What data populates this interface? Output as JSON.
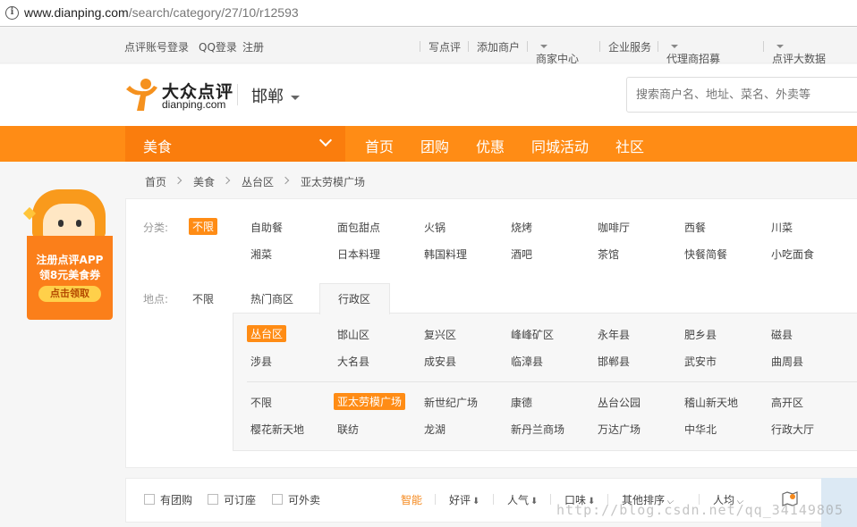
{
  "browser": {
    "url_host": "www.dianping.com",
    "url_path": "/search/category/27/10/r12593"
  },
  "topbar": {
    "login": "点评账号登录",
    "qq_login": "QQ登录",
    "register": "注册",
    "write_review": "写点评",
    "add_merchant": "添加商户",
    "merchant_center": "商家中心",
    "enterprise": "企业服务",
    "agent": "代理商招募",
    "bigdata": "点评大数据"
  },
  "header": {
    "logo_cn": "大众点评",
    "logo_en": "dianping.com",
    "city": "邯郸",
    "search_placeholder": "搜索商户名、地址、菜名、外卖等"
  },
  "nav": {
    "category": "美食",
    "items": [
      "首页",
      "团购",
      "优惠",
      "同城活动",
      "社区"
    ]
  },
  "breadcrumb": [
    "首页",
    "美食",
    "丛台区",
    "亚太劳模广场"
  ],
  "ad": {
    "line1": "注册点评APP",
    "line2": "领8元美食券",
    "button": "点击领取"
  },
  "filter": {
    "category_label": "分类:",
    "category_all": "不限",
    "categories_row1": [
      "自助餐",
      "面包甜点",
      "火锅",
      "烧烤",
      "咖啡厅",
      "西餐",
      "川菜"
    ],
    "categories_row2": [
      "湘菜",
      "日本料理",
      "韩国料理",
      "酒吧",
      "茶馆",
      "快餐简餐",
      "小吃面食"
    ],
    "location_label": "地点:",
    "location_all": "不限",
    "tab_hot": "热门商区",
    "tab_admin": "行政区",
    "districts_row1": [
      "丛台区",
      "邯山区",
      "复兴区",
      "峰峰矿区",
      "永年县",
      "肥乡县",
      "磁县"
    ],
    "districts_row2": [
      "涉县",
      "大名县",
      "成安县",
      "临漳县",
      "邯郸县",
      "武安市",
      "曲周县"
    ],
    "areas_row1": [
      "不限",
      "亚太劳模广场",
      "新世纪广场",
      "康德",
      "丛台公园",
      "稽山新天地",
      "高开区"
    ],
    "areas_row2": [
      "樱花新天地",
      "联纺",
      "龙湖",
      "新丹兰商场",
      "万达广场",
      "中华北",
      "行政大厅"
    ]
  },
  "sortbar": {
    "group_buy": "有团购",
    "reservable": "可订座",
    "takeout": "可外卖",
    "smart": "智能",
    "rating": "好评",
    "popularity": "人气",
    "taste": "口味",
    "other": "其他排序",
    "per_capita": "人均"
  },
  "watermark": "http://blog.csdn.net/qq_34149805"
}
